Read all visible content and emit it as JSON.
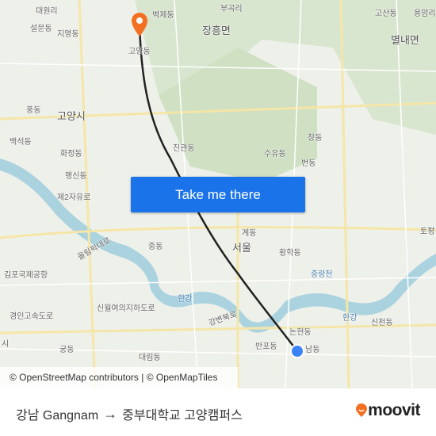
{
  "map": {
    "labels": {
      "daewonri": "대원리",
      "seoldong": "설문동",
      "jiyeongdong": "지영동",
      "byeokjedong": "벽제동",
      "bukhangri": "부곡리",
      "janghungmyeon": "장흥면",
      "gosandong": "고산동",
      "yongamri": "용암리",
      "byeollaemyeon": "별내면",
      "goyangdong": "고양동",
      "pungdong": "풍동",
      "goyangsi": "고양시",
      "baekseokdong": "백석동",
      "hwajeongdong": "화정동",
      "haengsindong": "행신동",
      "jingwandong": "진관동",
      "suyudong": "수유동",
      "changdong": "창동",
      "beondong": "번동",
      "jaeil": "제2자유로",
      "gyedong": "계동",
      "seoul": "서울",
      "hwanghakdong": "황학동",
      "jungdong": "중동",
      "jungnangcheon": "중랑천",
      "gimpo": "김포국제공항",
      "hangang1": "한강",
      "hangang2": "한강",
      "olympic": "올림픽대로",
      "gangbyeon": "강변북로",
      "gyeongin": "경인고속도로",
      "sinwol": "신월여의지하도로",
      "gungdong": "궁동",
      "daerimdong": "대림동",
      "banpodong": "반포동",
      "nonhyeondong": "논현동",
      "sincheondong": "신천동",
      "gangnamdong": "남동",
      "topyeong": "토평",
      "hoesi": "시"
    },
    "route_color": "#222222",
    "origin_marker_color": "#f36f21",
    "destination_marker_color": "#3b82f6",
    "water_color": "#aad3df"
  },
  "cta": {
    "label": "Take me there",
    "color": "#1a73e8"
  },
  "attribution": "© OpenStreetMap contributors | © OpenMapTiles",
  "footer": {
    "origin": "강남 Gangnam",
    "arrow": "→",
    "destination": "중부대학교 고양캠퍼스",
    "brand": "moovit",
    "brand_color": "#f36f21"
  }
}
